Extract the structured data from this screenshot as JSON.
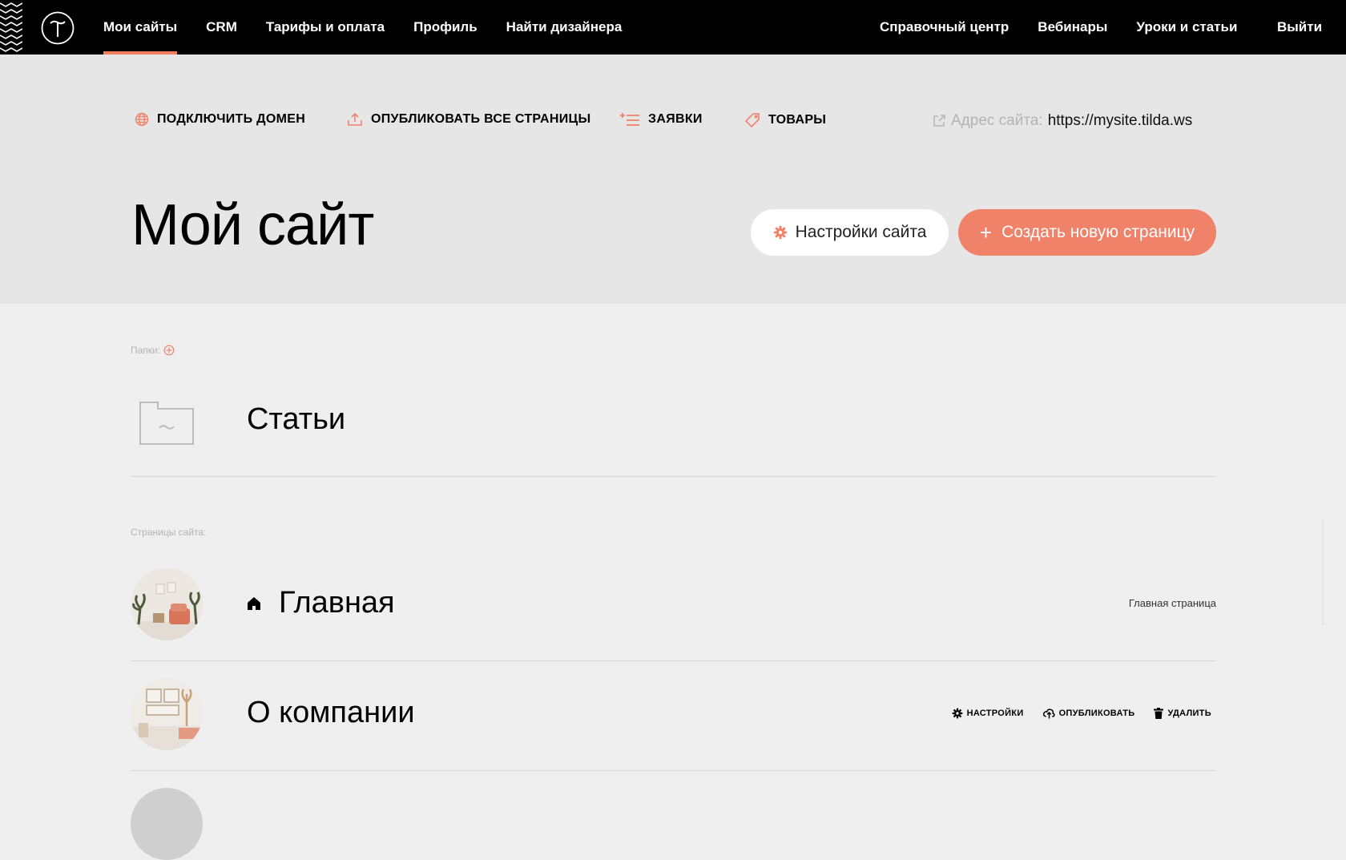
{
  "topbar": {
    "nav_left": [
      "Мои сайты",
      "CRM",
      "Тарифы и оплата",
      "Профиль",
      "Найти дизайнера"
    ],
    "nav_right": [
      "Справочный центр",
      "Вебинары",
      "Уроки и статьи"
    ],
    "logout": "Выйти",
    "active_index": 0
  },
  "toolbar": {
    "connect_domain": "ПОДКЛЮЧИТЬ ДОМЕН",
    "publish_all": "ОПУБЛИКОВАТЬ ВСЕ СТРАНИЦЫ",
    "leads": "ЗАЯВКИ",
    "products": "ТОВАРЫ",
    "site_address_label": "Адрес сайта:",
    "site_address_url": "https://mysite.tilda.ws"
  },
  "header": {
    "title": "Мой сайт",
    "settings_button": "Настройки сайта",
    "create_button": "Создать новую страницу"
  },
  "folders": {
    "label": "Папки:",
    "items": [
      {
        "name": "Статьи"
      }
    ]
  },
  "pages": {
    "label": "Страницы сайта:",
    "items": [
      {
        "name": "Главная",
        "note": "Главная страница"
      },
      {
        "name": "О компании",
        "settings": "НАСТРОЙКИ",
        "publish": "ОПУБЛИКОВАТЬ",
        "delete": "УДАЛИТЬ"
      }
    ]
  },
  "colors": {
    "accent": "#f0826a",
    "topbar": "#000000",
    "header_bg": "#e6e6e6",
    "page_bg": "#efefef"
  }
}
